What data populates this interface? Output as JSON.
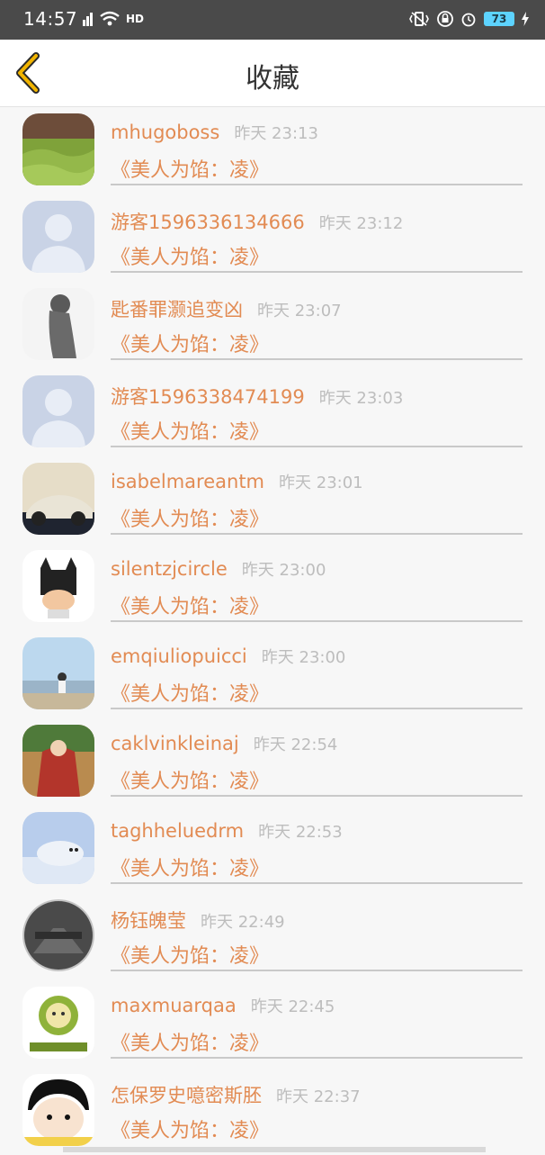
{
  "status_bar": {
    "time": "14:57",
    "network": "4G",
    "wifi_label": "HD",
    "battery": "73"
  },
  "header": {
    "title": "收藏",
    "back_icon": "chevron-left-icon"
  },
  "colors": {
    "accent": "#e28b53",
    "time_gray": "#bdbdbd",
    "back_arrow": "#f1b400"
  },
  "favorites": [
    {
      "user": "mhugoboss",
      "time": "昨天 23:13",
      "book": "《美人为馅：凌》",
      "avatar": "grass-field-avatar"
    },
    {
      "user": "游客1596336134666",
      "time": "昨天 23:12",
      "book": "《美人为馅：凌》",
      "avatar": "default-person-avatar"
    },
    {
      "user": "匙番罪灏追变凶",
      "time": "昨天 23:07",
      "book": "《美人为馅：凌》",
      "avatar": "silhouette-girl-avatar"
    },
    {
      "user": "游客1596338474199",
      "time": "昨天 23:03",
      "book": "《美人为馅：凌》",
      "avatar": "default-person-avatar"
    },
    {
      "user": "isabelmareantm",
      "time": "昨天 23:01",
      "book": "《美人为馅：凌》",
      "avatar": "sports-car-avatar"
    },
    {
      "user": "silentzjcircle",
      "time": "昨天 23:00",
      "book": "《美人为馅：凌》",
      "avatar": "batman-cartoon-avatar"
    },
    {
      "user": "emqiuliopuicci",
      "time": "昨天 23:00",
      "book": "《美人为馅：凌》",
      "avatar": "beach-person-avatar"
    },
    {
      "user": "caklvinkleinaj",
      "time": "昨天 22:54",
      "book": "《美人为馅：凌》",
      "avatar": "costume-figure-avatar"
    },
    {
      "user": "taghheluedrm",
      "time": "昨天 22:53",
      "book": "《美人为馅：凌》",
      "avatar": "seal-pup-avatar"
    },
    {
      "user": "杨钰魄莹",
      "time": "昨天 22:49",
      "book": "《美人为馅：凌》",
      "avatar": "city-street-avatar"
    },
    {
      "user": "maxmuarqaa",
      "time": "昨天 22:45",
      "book": "《美人为馅：凌》",
      "avatar": "sun-god-avatar"
    },
    {
      "user": "怎保罗史噫密斯胚",
      "time": "昨天 22:37",
      "book": "《美人为馅：凌》",
      "avatar": "cartoon-girl-avatar"
    }
  ]
}
